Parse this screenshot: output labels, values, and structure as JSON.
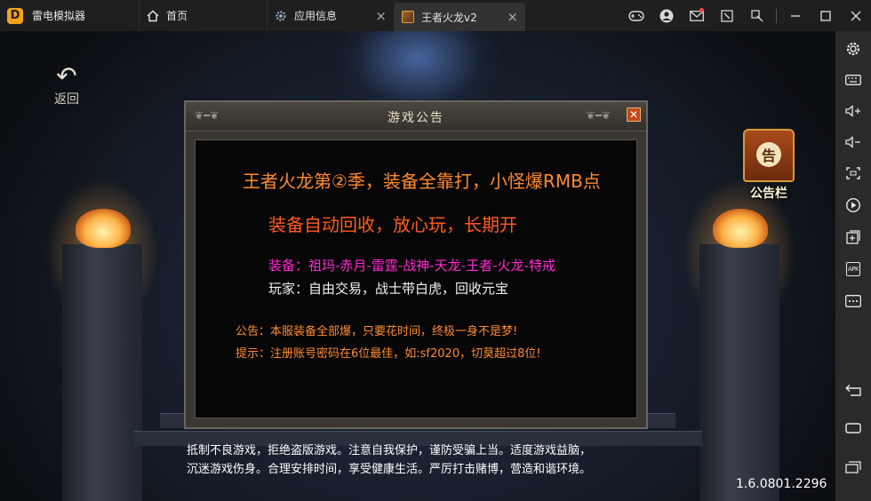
{
  "window": {
    "app_name": "雷电模拟器",
    "tabs": [
      {
        "label": "首页",
        "icon": "home-icon"
      },
      {
        "label": "应用信息",
        "icon": "gear-icon"
      },
      {
        "label": "王者火龙v2",
        "icon": "game-icon",
        "active": true
      }
    ],
    "controls": [
      "gamepad-icon",
      "user-icon",
      "mail-icon",
      "minimize-to-tray-icon",
      "screenshot-tool-icon",
      "minimize-icon",
      "maximize-icon",
      "close-icon"
    ]
  },
  "sidebar": {
    "buttons": [
      "settings-icon",
      "keyboard-icon",
      "volume-up-icon",
      "volume-down-icon",
      "fullscreen-icon",
      "video-record-icon",
      "add-multi-instance-icon",
      "apk-install-icon",
      "more-icon",
      "back-icon",
      "home-icon",
      "recent-apps-icon"
    ],
    "apk_label": "APK"
  },
  "game": {
    "back_label": "返回",
    "board_label": "公告栏",
    "board_char": "告",
    "notice": {
      "title": "游戏公告",
      "close": "✕",
      "lines": [
        "王者火龙第②季，装备全靠打，小怪爆RMB点",
        "装备自动回收，放心玩，长期开",
        "装备：祖玛-赤月-雷霆-战神-天龙-王者-火龙-特戒",
        "玩家：自由交易，战士带白虎，回收元宝",
        "公告：本服装备全部爆，只要花时间，终极一身不是梦!",
        "提示：注册账号密码在6位最佳，如:sf2020，切莫超过8位!"
      ]
    },
    "health_notice": [
      "抵制不良游戏，拒绝盗版游戏。注意自我保护，谨防受骗上当。适度游戏益脑，",
      "沉迷游戏伤身。合理安排时间，享受健康生活。严厉打击赌博，营造和谐环境。"
    ],
    "version": "1.6.0801.2296"
  }
}
